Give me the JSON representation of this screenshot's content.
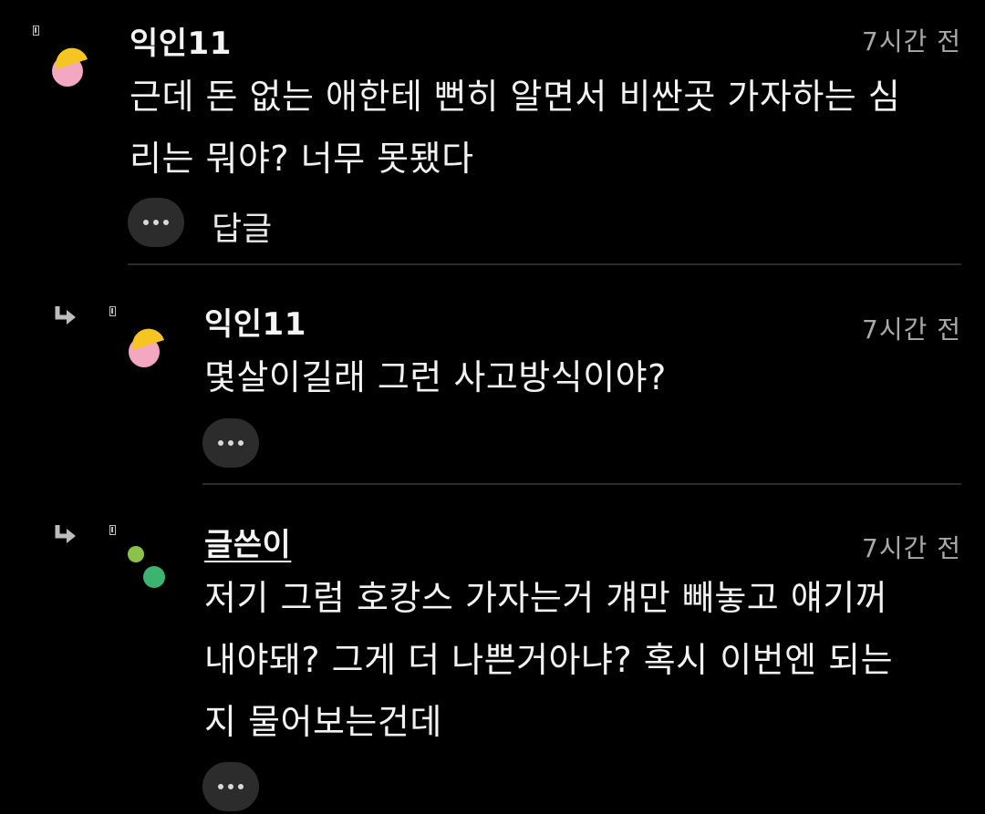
{
  "comments": [
    {
      "author": "익인11",
      "time": "7시간 전",
      "text_lines": [
        "근데 돈 없는 애한테 뻔히 알면서 비싼곳 가자하는 심",
        "리는 뭐야? 너무 못됐다"
      ],
      "reply_label": "답글",
      "more_icon": "more-horizontal-icon"
    },
    {
      "author": "익인11",
      "time": "7시간 전",
      "text_lines": [
        "몇살이길래 그런 사고방식이야?"
      ],
      "more_icon": "more-horizontal-icon"
    },
    {
      "author": "글쓴이",
      "time": "7시간 전",
      "text_lines": [
        "저기 그럼 호캉스 가자는거 걔만 빼놓고 얘기꺼",
        "내야돼? 그게 더 나쁜거아냐? 혹시 이번엔 되는",
        "지 물어보는건데"
      ],
      "more_icon": "more-horizontal-icon"
    }
  ],
  "colors": {
    "background": "#000000",
    "avatar_yellow": "#f5c623",
    "avatar_pink": "#f3a7c1",
    "author_green_small": "#8bc34a",
    "author_green_large": "#3cb371",
    "button_bg": "#2c2c2c",
    "divider": "#2a2a2a"
  }
}
